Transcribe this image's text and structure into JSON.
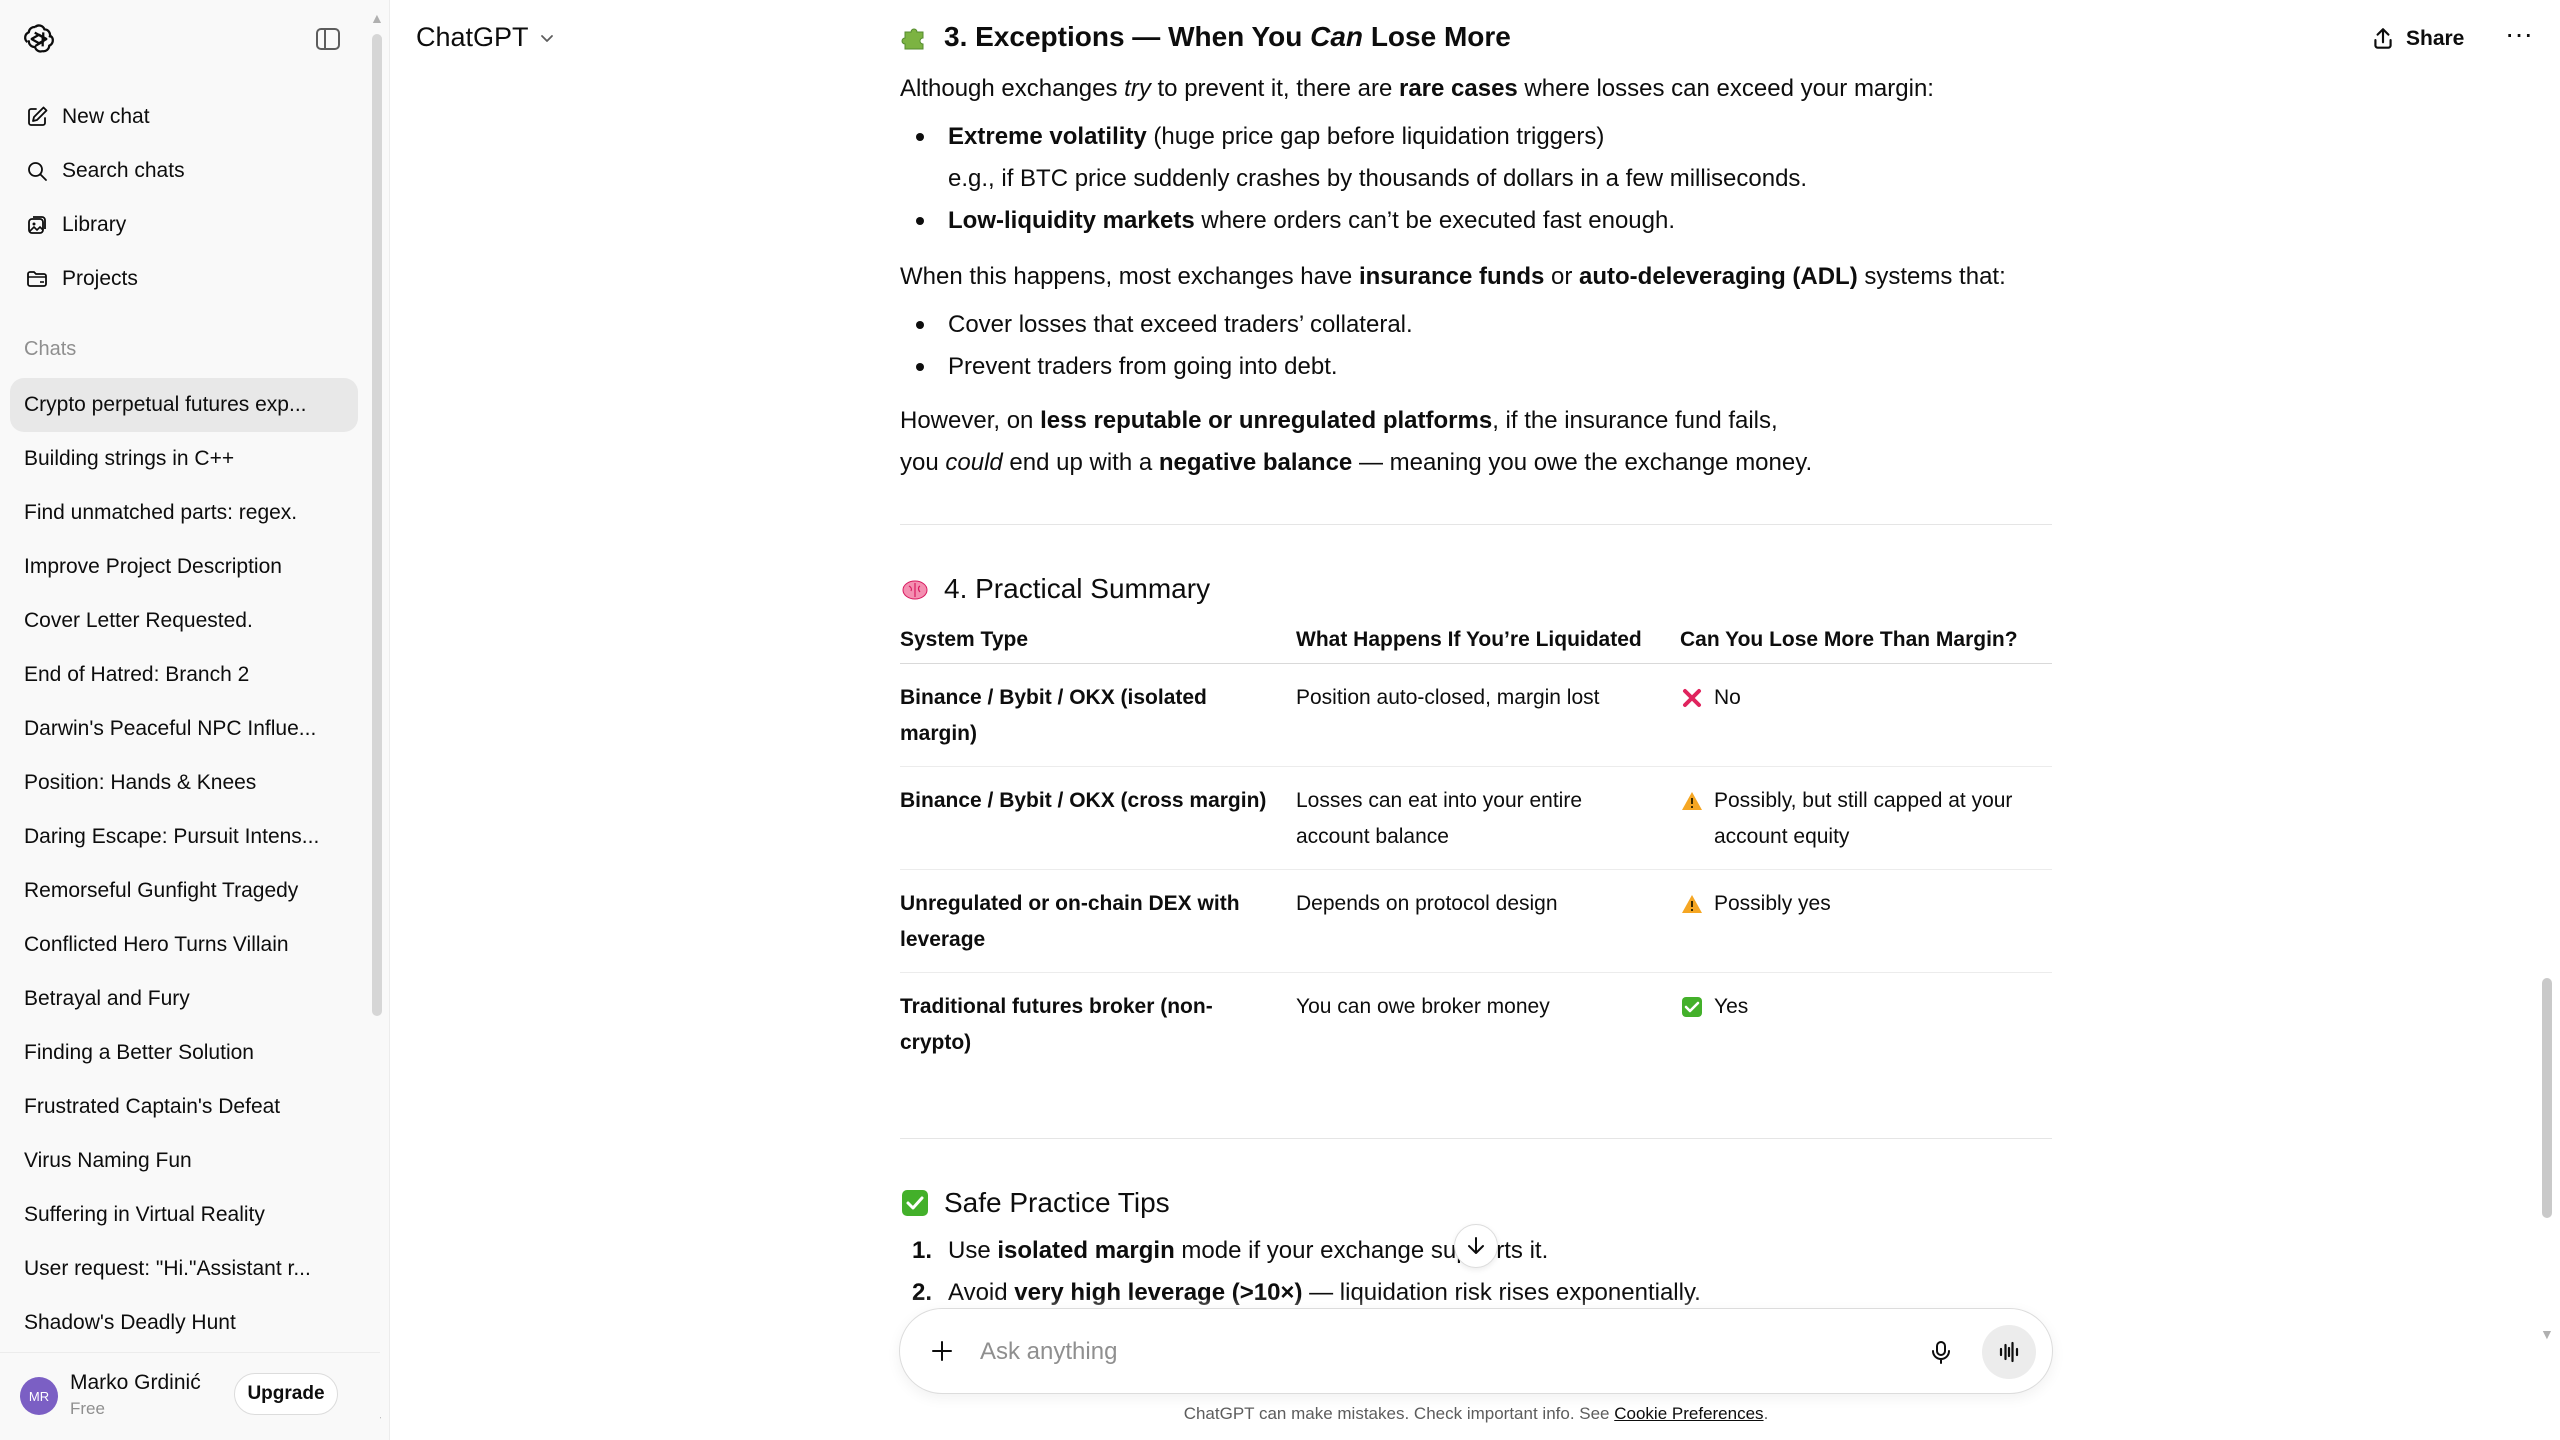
{
  "app": {
    "model_label": "ChatGPT",
    "share_label": "Share",
    "more_label": "···"
  },
  "sidebar": {
    "nav": [
      {
        "label": "New chat",
        "icon": "pencil-square-icon"
      },
      {
        "label": "Search chats",
        "icon": "search-icon"
      },
      {
        "label": "Library",
        "icon": "library-icon"
      },
      {
        "label": "Projects",
        "icon": "folder-icon"
      }
    ],
    "section_label": "Chats",
    "chats": [
      "Crypto perpetual futures exp...",
      "Building strings in C++",
      "Find unmatched parts: regex.",
      "Improve Project Description",
      "Cover Letter Requested.",
      "End of Hatred: Branch 2",
      "Darwin's Peaceful NPC Influe...",
      "Position: Hands & Knees",
      "Daring Escape: Pursuit Intens...",
      "Remorseful Gunfight Tragedy",
      "Conflicted Hero Turns Villain",
      "Betrayal and Fury",
      "Finding a Better Solution",
      "Frustrated Captain's Defeat",
      "Virus Naming Fun",
      "Suffering in Virtual Reality",
      "User request: \"Hi.\"Assistant r...",
      "Shadow's Deadly Hunt"
    ],
    "user": {
      "initials": "MR",
      "name": "Marko Grdinić",
      "plan": "Free",
      "upgrade_label": "Upgrade"
    }
  },
  "message": {
    "s3": {
      "title_a": "3. Exceptions — When You ",
      "title_em": "Can",
      "title_b": " Lose More",
      "p1": [
        "Although exchanges ",
        "try",
        " to prevent it, there are ",
        "rare cases",
        " where losses can exceed your margin:"
      ],
      "b1_bold": "Extreme volatility",
      "b1_rest": " (huge price gap before liquidation triggers)",
      "b1_sub": "e.g., if BTC price suddenly crashes by thousands of dollars in a few milliseconds.",
      "b2_bold": "Low-liquidity markets",
      "b2_rest": " where orders can’t be executed fast enough.",
      "p2": [
        "When this happens, most exchanges have ",
        "insurance funds",
        " or ",
        "auto-deleveraging (ADL)",
        " systems that:"
      ],
      "b3": "Cover losses that exceed traders’ collateral.",
      "b4": "Prevent traders from going into debt.",
      "p3": [
        "However, on ",
        "less reputable or unregulated platforms",
        ", if the insurance fund fails,"
      ],
      "p4": [
        "you ",
        "could",
        " end up with a ",
        "negative balance",
        " — meaning you owe the exchange money."
      ]
    },
    "s4": {
      "title": "4. Practical Summary",
      "headers": [
        "System Type",
        "What Happens If You’re Liquidated",
        "Can You Lose More Than Margin?"
      ],
      "rows": [
        {
          "system": "Binance / Bybit / OKX (isolated margin)",
          "what": "Position auto-closed, margin lost",
          "can": "No",
          "icon": "cross-mark-icon"
        },
        {
          "system": "Binance / Bybit / OKX (cross margin)",
          "what": "Losses can eat into your entire account balance",
          "can": "Possibly, but still capped at your account equity",
          "icon": "warning-icon"
        },
        {
          "system": "Unregulated or on-chain DEX with leverage",
          "what": "Depends on protocol design",
          "can": "Possibly yes",
          "icon": "warning-icon"
        },
        {
          "system": "Traditional futures broker (non-crypto)",
          "what": "You can owe broker money",
          "can": "Yes",
          "icon": "check-mark-icon"
        }
      ]
    },
    "s5": {
      "title": "Safe Practice Tips",
      "items": [
        {
          "num": "1.",
          "a": "Use ",
          "bold": "isolated margin",
          "b": " mode if your exchange supports it."
        },
        {
          "num": "2.",
          "a": "Avoid ",
          "bold": "very high leverage (>10×)",
          "b": " — liquidation risk rises exponentially."
        }
      ]
    }
  },
  "composer": {
    "placeholder": "Ask anything"
  },
  "footer": {
    "text": "ChatGPT can make mistakes. Check important info. See ",
    "link": "Cookie Preferences",
    "end": "."
  },
  "colors": {
    "sidebar_bg": "#f9f9f9",
    "active_chat_bg": "#e8e8e8",
    "warning": "#f5a623",
    "cross": "#e0245e",
    "check": "#43b02a"
  }
}
